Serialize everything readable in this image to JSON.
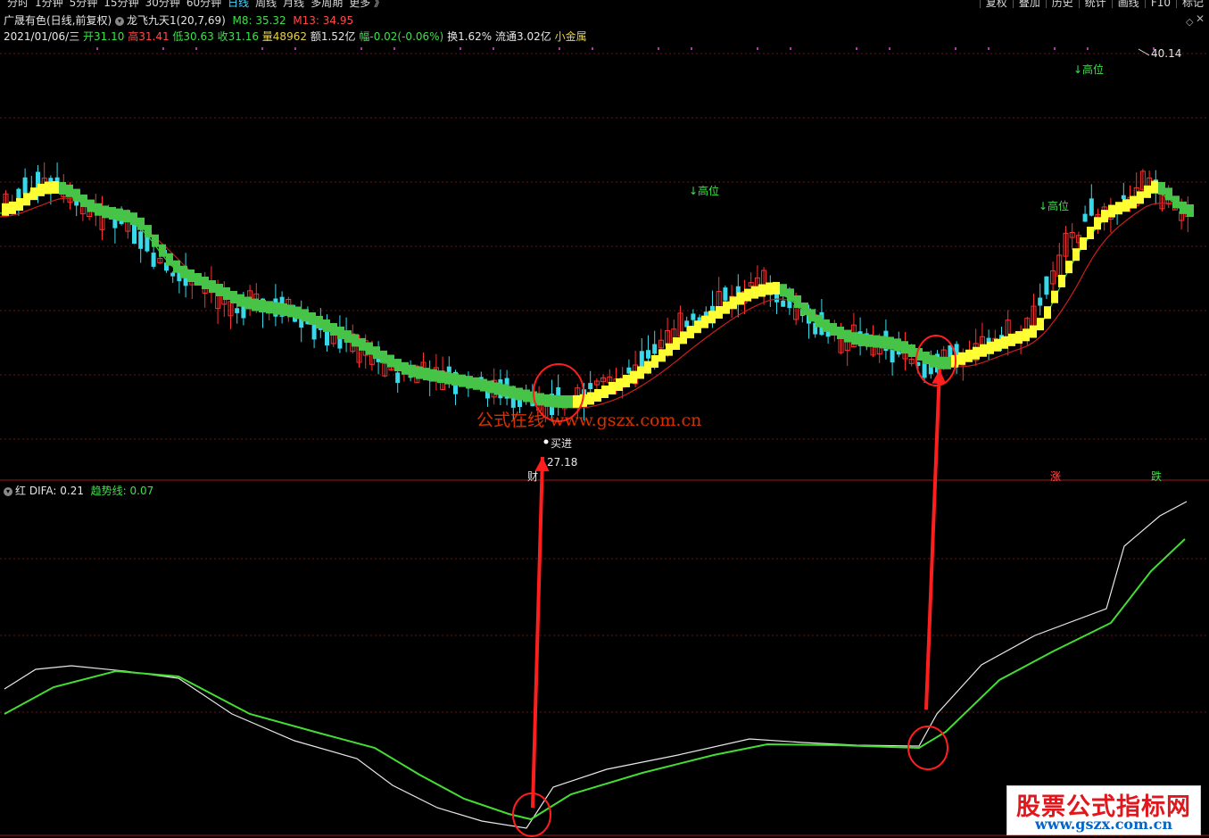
{
  "toolbar": {
    "tabs": [
      "分时",
      "1分钟",
      "5分钟",
      "15分钟",
      "30分钟",
      "60分钟",
      "日线",
      "周线",
      "月线",
      "多周期",
      "更多 》"
    ],
    "active_tab": "日线",
    "right_buttons": [
      "复权",
      "叠加",
      "历史",
      "统计",
      "画线",
      "F10",
      "标记"
    ]
  },
  "stock": {
    "name": "广晟有色(日线,前复权)",
    "indicator_name": "龙飞九天1(20,7,69)",
    "m8_label": "M8: 35.32",
    "m13_label": "M13: 34.95",
    "date": "2021/01/06/三",
    "open": "开31.10",
    "high": "高31.41",
    "low": "低30.63",
    "close": "收31.16",
    "volume": "量48962",
    "amount": "额1.52亿",
    "change": "幅-0.02(-0.06%)",
    "turnover": "换1.62%",
    "float": "流通3.02亿",
    "tag": "小金属"
  },
  "window_controls": {
    "close": "✕",
    "restore": "◇"
  },
  "annotations": {
    "high_label": "↓高位",
    "buy_label": "买进",
    "low_price": "27.18",
    "high_price": "40.14",
    "cai_label": "财",
    "zhang_label": "涨",
    "die_label": "跌"
  },
  "indicator": {
    "prefix": "红",
    "difa_label": "DIFA: 0.21",
    "trend_label": "趋势线: 0.07"
  },
  "watermark": {
    "prefix": "公式在线",
    "url": "www.gszx.com.cn"
  },
  "brand": {
    "title": "股票公式指标网",
    "url": "www.gszx.com.cn"
  },
  "colors": {
    "up_candle": "#ff3030",
    "down_candle": "#38d8e8",
    "band_up": "#ffff33",
    "band_down": "#47c447",
    "ma_red": "#c81e1e",
    "ma_green": "#3ed23e",
    "difa_line": "#e8e8e8",
    "trend_line": "#44dd33",
    "arrow": "#ff1e1e"
  },
  "chart_data": [
    {
      "type": "line",
      "series": [
        {
          "name": "M8",
          "values": [
            35.32
          ]
        },
        {
          "name": "M13",
          "values": [
            34.95
          ]
        }
      ],
      "ohlc_last": {
        "date": "2021/01/06",
        "open": 31.1,
        "high": 31.41,
        "low": 30.63,
        "close": 31.16
      },
      "marked_low": 27.18,
      "marked_high": 40.14
    },
    {
      "type": "line",
      "series": [
        {
          "name": "DIFA",
          "values": [
            0.21
          ]
        },
        {
          "name": "趋势线",
          "values": [
            0.07
          ]
        }
      ]
    }
  ]
}
